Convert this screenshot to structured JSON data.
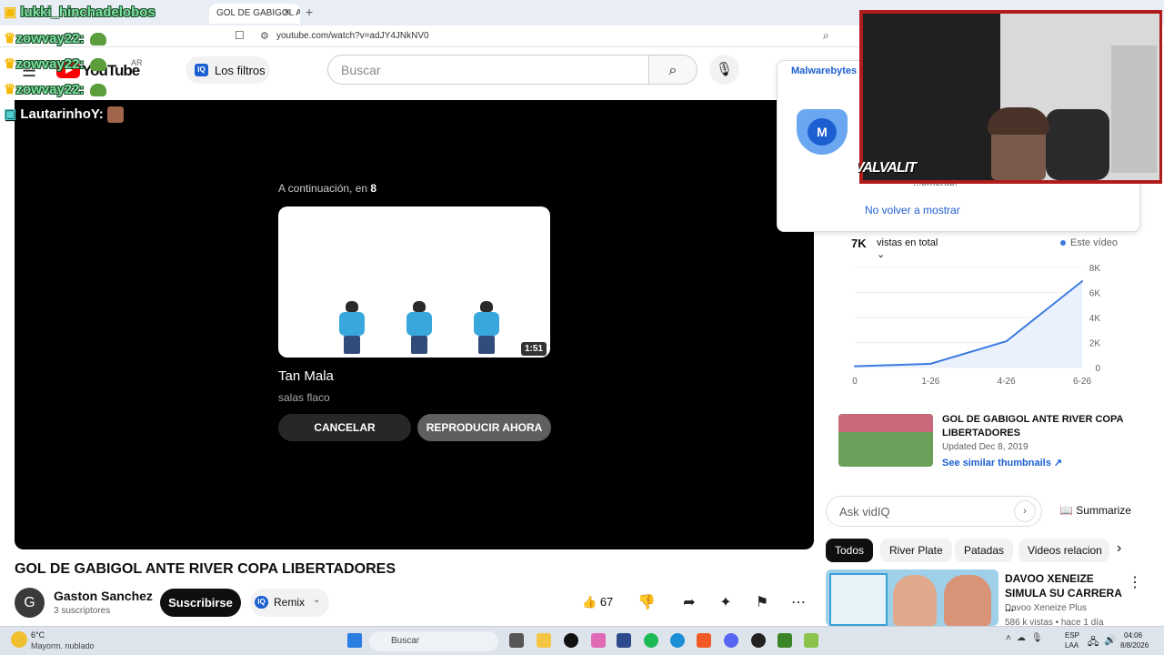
{
  "browser": {
    "tab_title": "GOL DE GABIGOL ANTE",
    "tab_close": "×",
    "new_tab": "+",
    "url": "youtube.com/watch?v=adJY4JNkNV0"
  },
  "chat": {
    "line1_user": "lukki_hinchadelobos",
    "line2_user": "zowvay22:",
    "line3_user": "zowvay22:",
    "line4_user": "zowvay22:",
    "line5_user": "LautarinhoY:"
  },
  "header": {
    "logo_text": "YouTube",
    "region": "AR",
    "filters_label": "Los filtros",
    "iq_badge": "IQ",
    "search_placeholder": "Buscar"
  },
  "player": {
    "up_next_prefix": "A continuación, en",
    "up_next_seconds": "8",
    "duration": "1:51",
    "next_title": "Tan Mala",
    "next_channel": "salas flaco",
    "cancel_label": "CANCELAR",
    "play_label": "REPRODUCIR AHORA"
  },
  "video": {
    "title": "GOL DE GABIGOL ANTE RIVER COPA LIBERTADORES",
    "channel_initial": "G",
    "channel_name": "Gaston Sanchez",
    "subscribers": "3 suscriptores",
    "subscribe_label": "Suscribirse",
    "remix_label": "Remix",
    "likes": "67"
  },
  "popup": {
    "brand": "Malwarebytes",
    "message": "...omento.",
    "dismiss": "No volver a mostrar"
  },
  "webcam": {
    "logo": "VALVALIT"
  },
  "stats": {
    "views": "7K",
    "views_select": "vistas en total",
    "legend": "Este vídeo",
    "accent": "#3b7be0"
  },
  "chart_data": {
    "type": "line",
    "x": [
      "0",
      "1-26",
      "4-26",
      "6-26"
    ],
    "series": [
      {
        "values": [
          100,
          300,
          2100,
          6900
        ]
      }
    ],
    "y_ticks": [
      "0",
      "2K",
      "4K",
      "6K",
      "8K"
    ],
    "ylim": [
      0,
      8000
    ],
    "grid": true
  },
  "related": {
    "title": "GOL DE GABIGOL ANTE RIVER COPA LIBERTADORES",
    "updated": "Updated Dec 8, 2019",
    "link": "See similar thumbnails ↗"
  },
  "vidiq": {
    "ask_placeholder": "Ask vidIQ",
    "summarize": "Summarize"
  },
  "chips": [
    "Todos",
    "River Plate",
    "Patadas",
    "Videos relacion"
  ],
  "recommendation": {
    "title": "DAVOO XENEIZE SIMULA SU CARRERA ...",
    "channel": "Davoo Xeneize Plus",
    "meta": "586 k vistas • hace 1 día"
  },
  "taskbar": {
    "temp": "6°C",
    "weather": "Mayorm. nublado",
    "search": "Buscar",
    "lang1": "ESP",
    "lang2": "LAA",
    "time": "04:06",
    "date": "8/8/2026"
  }
}
